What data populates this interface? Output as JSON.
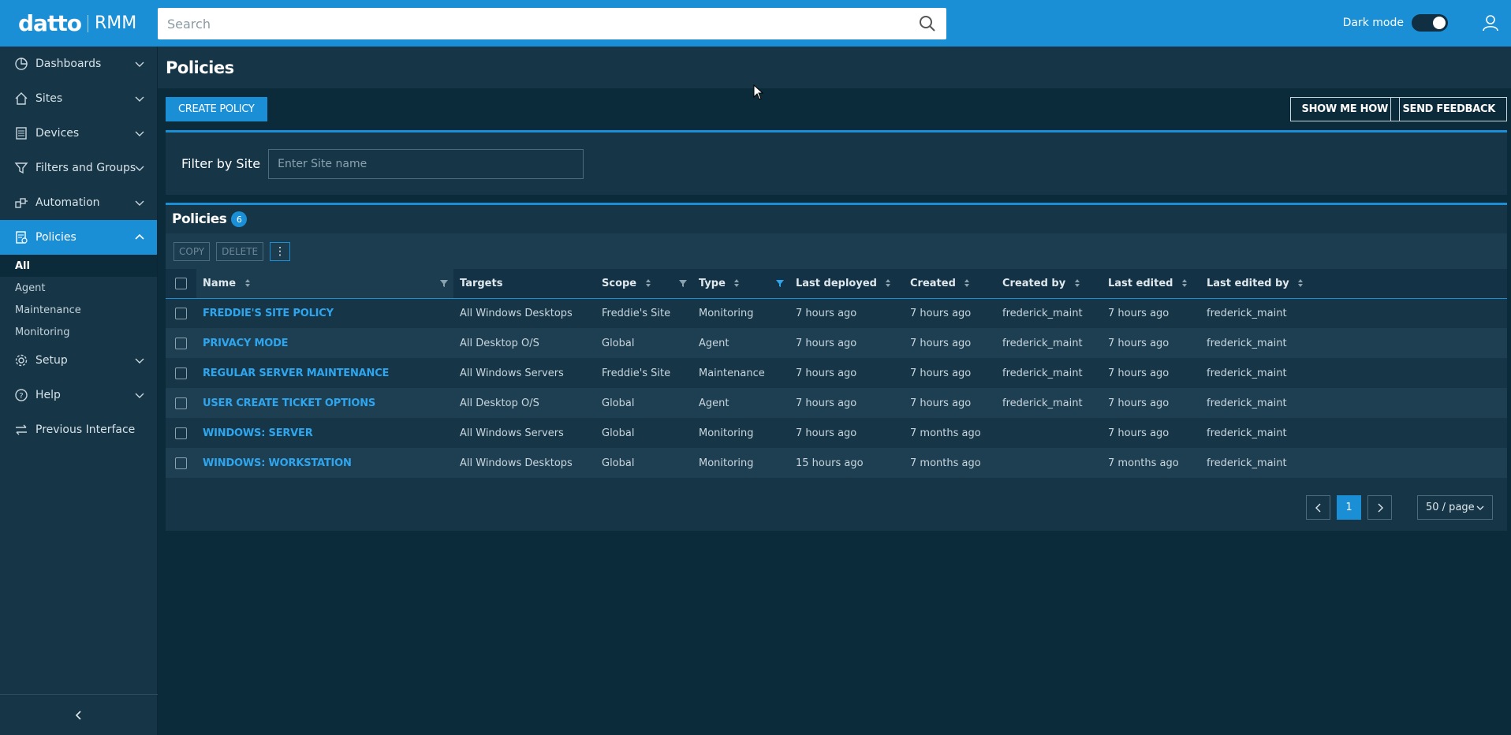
{
  "brand": {
    "name": "datto",
    "product": "RMM"
  },
  "search": {
    "placeholder": "Search"
  },
  "header": {
    "dark_mode_label": "Dark mode",
    "dark_mode_on": true
  },
  "sidebar": {
    "items": [
      {
        "label": "Dashboards",
        "icon": "dashboard-icon"
      },
      {
        "label": "Sites",
        "icon": "home-icon"
      },
      {
        "label": "Devices",
        "icon": "device-icon"
      },
      {
        "label": "Filters and Groups",
        "icon": "filter-icon"
      },
      {
        "label": "Automation",
        "icon": "automation-icon"
      },
      {
        "label": "Policies",
        "icon": "policy-icon",
        "active": true
      },
      {
        "label": "Setup",
        "icon": "gear-icon"
      },
      {
        "label": "Help",
        "icon": "help-icon"
      },
      {
        "label": "Previous Interface",
        "icon": "switch-icon"
      }
    ],
    "policies_sub": [
      "All",
      "Agent",
      "Maintenance",
      "Monitoring"
    ]
  },
  "page": {
    "title": "Policies",
    "create_button": "CREATE POLICY",
    "show_me_how": "SHOW ME HOW",
    "send_feedback": "SEND FEEDBACK"
  },
  "filter": {
    "label": "Filter by Site",
    "placeholder": "Enter Site name"
  },
  "table": {
    "title": "Policies",
    "count": "6",
    "copy_label": "COPY",
    "delete_label": "DELETE",
    "more_label": "⋮",
    "columns": [
      "Name",
      "Targets",
      "Scope",
      "Type",
      "Last deployed",
      "Created",
      "Created by",
      "Last edited",
      "Last edited by"
    ],
    "rows": [
      {
        "name": "FREDDIE'S SITE POLICY",
        "targets": "All Windows Desktops",
        "scope": "Freddie's Site",
        "type": "Monitoring",
        "last_deployed": "7 hours ago",
        "created": "7 hours ago",
        "created_by": "frederick_maint",
        "last_edited": "7 hours ago",
        "last_edited_by": "frederick_maint"
      },
      {
        "name": "PRIVACY MODE",
        "targets": "All Desktop O/S",
        "scope": "Global",
        "type": "Agent",
        "last_deployed": "7 hours ago",
        "created": "7 hours ago",
        "created_by": "frederick_maint",
        "last_edited": "7 hours ago",
        "last_edited_by": "frederick_maint"
      },
      {
        "name": "REGULAR SERVER MAINTENANCE",
        "targets": "All Windows Servers",
        "scope": "Freddie's Site",
        "type": "Maintenance",
        "last_deployed": "7 hours ago",
        "created": "7 hours ago",
        "created_by": "frederick_maint",
        "last_edited": "7 hours ago",
        "last_edited_by": "frederick_maint"
      },
      {
        "name": "USER CREATE TICKET OPTIONS",
        "targets": "All Desktop O/S",
        "scope": "Global",
        "type": "Agent",
        "last_deployed": "7 hours ago",
        "created": "7 hours ago",
        "created_by": "frederick_maint",
        "last_edited": "7 hours ago",
        "last_edited_by": "frederick_maint"
      },
      {
        "name": "WINDOWS: SERVER",
        "targets": "All Windows Servers",
        "scope": "Global",
        "type": "Monitoring",
        "last_deployed": "7 hours ago",
        "created": "7 months ago",
        "created_by": "",
        "last_edited": "7 hours ago",
        "last_edited_by": "frederick_maint"
      },
      {
        "name": "WINDOWS: WORKSTATION",
        "targets": "All Windows Desktops",
        "scope": "Global",
        "type": "Monitoring",
        "last_deployed": "15 hours ago",
        "created": "7 months ago",
        "created_by": "",
        "last_edited": "7 months ago",
        "last_edited_by": "frederick_maint"
      }
    ]
  },
  "pagination": {
    "current_page": "1",
    "page_size": "50 / page"
  },
  "colors": {
    "accent": "#1a8fd6",
    "background": "#0b2a3a",
    "panel": "#163648",
    "link": "#2ea6ef"
  }
}
